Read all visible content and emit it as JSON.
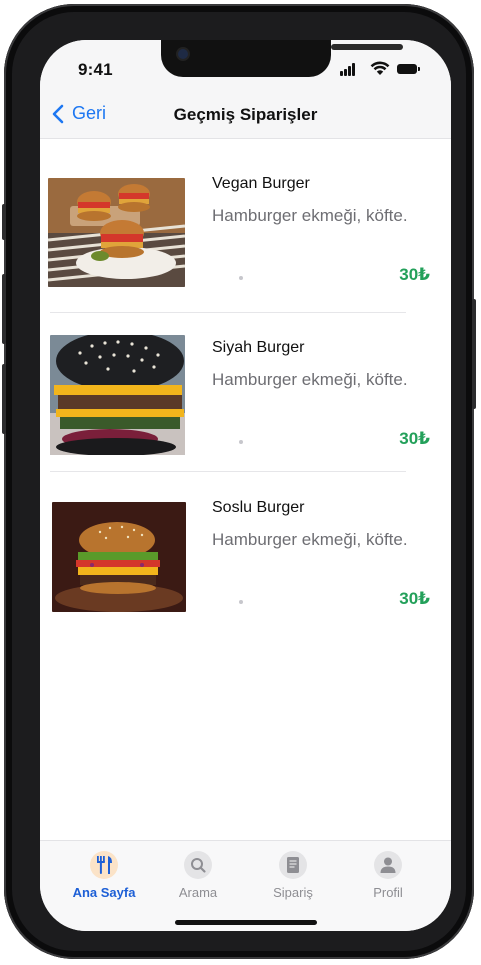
{
  "status_bar": {
    "time": "9:41"
  },
  "nav": {
    "back_label": "Geri",
    "title": "Geçmiş Siparişler"
  },
  "orders": [
    {
      "name": "Vegan Burger",
      "description": "Hamburger ekmeği, köfte.",
      "price": "30₺"
    },
    {
      "name": "Siyah Burger",
      "description": "Hamburger ekmeği, köfte.",
      "price": "30₺"
    },
    {
      "name": "Soslu Burger",
      "description": "Hamburger ekmeği, köfte.",
      "price": "30₺"
    }
  ],
  "tabs": [
    {
      "label": "Ana Sayfa",
      "icon": "fork-knife-icon",
      "active": true
    },
    {
      "label": "Arama",
      "icon": "search-icon",
      "active": false
    },
    {
      "label": "Sipariş",
      "icon": "receipt-icon",
      "active": false
    },
    {
      "label": "Profil",
      "icon": "person-icon",
      "active": false
    }
  ],
  "colors": {
    "accent": "#1d77f2",
    "price": "#23a05a",
    "active_tab": "#1d5fd6",
    "inactive_tab": "#8e8e93"
  }
}
